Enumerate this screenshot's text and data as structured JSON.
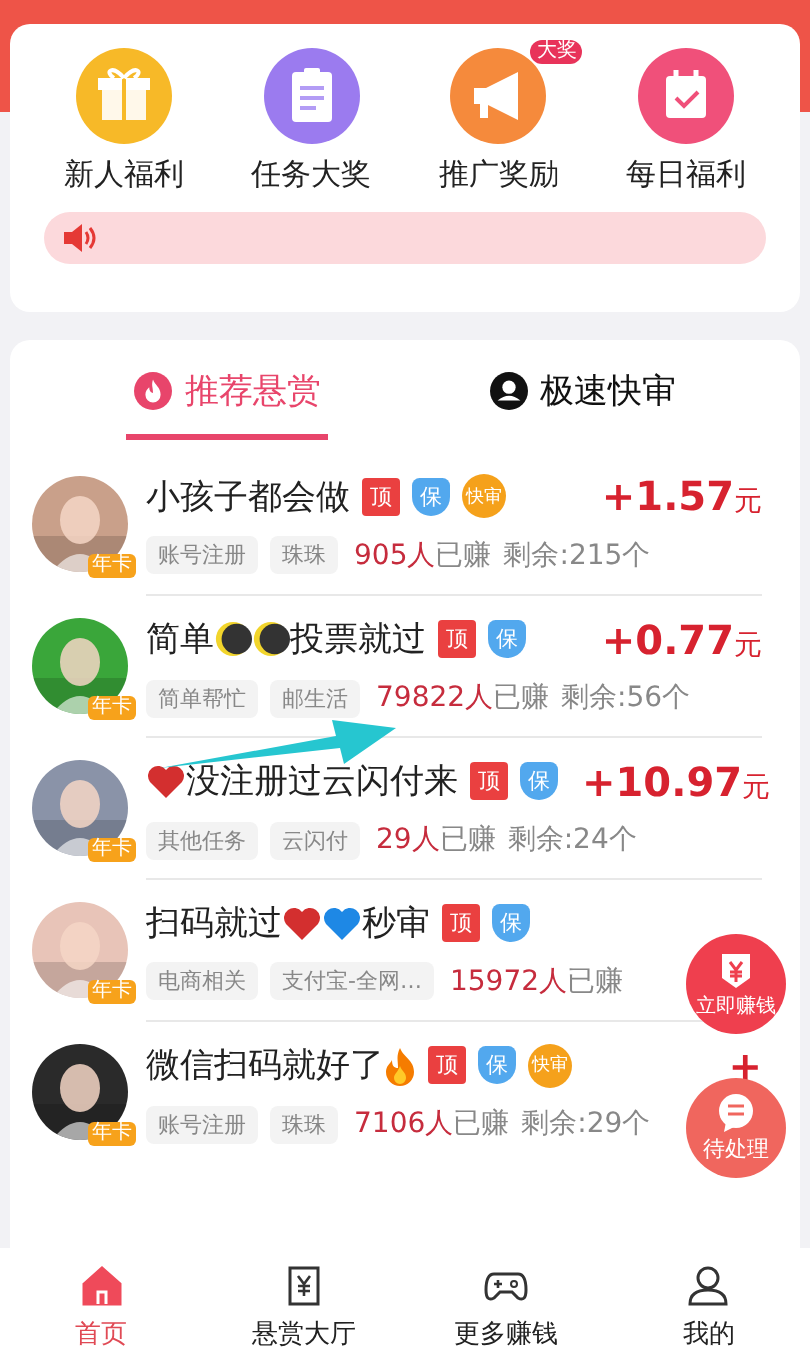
{
  "shortcuts": [
    {
      "kind": "gift",
      "label": "新人福利"
    },
    {
      "kind": "clipboard",
      "label": "任务大奖"
    },
    {
      "kind": "megaphone",
      "label": "推广奖励",
      "badge": "大奖"
    },
    {
      "kind": "calendar",
      "label": "每日福利"
    }
  ],
  "tabs": [
    {
      "label": "推荐悬赏",
      "kind": "fire",
      "selected": true
    },
    {
      "label": "极速快审",
      "kind": "person",
      "selected": false
    }
  ],
  "tasks": [
    {
      "avatar_badge": "年卡",
      "title": [
        {
          "kind": "text",
          "text": "小孩子都会做"
        }
      ],
      "badges": [
        {
          "kind": "top",
          "text": "顶"
        },
        {
          "kind": "guarantee",
          "text": "保"
        },
        {
          "kind": "fast",
          "text": "快审"
        }
      ],
      "price": "+1.57",
      "unit": "元",
      "tags": [
        "账号注册",
        "珠珠"
      ],
      "earned": "905人",
      "earned_suffix": "已赚",
      "remaining": "剩余:215个"
    },
    {
      "avatar_badge": "年卡",
      "title": [
        {
          "kind": "text",
          "text": "简单"
        },
        {
          "kind": "moon"
        },
        {
          "kind": "moon"
        },
        {
          "kind": "text",
          "text": "投票就过"
        }
      ],
      "badges": [
        {
          "kind": "top",
          "text": "顶"
        },
        {
          "kind": "guarantee",
          "text": "保"
        }
      ],
      "price": "+0.77",
      "unit": "元",
      "tags": [
        "简单帮忙",
        "邮生活"
      ],
      "earned": "79822人",
      "earned_suffix": "已赚",
      "remaining": "剩余:56个"
    },
    {
      "avatar_badge": "年卡",
      "title": [
        {
          "kind": "heart",
          "color": "#d32f2f"
        },
        {
          "kind": "text",
          "text": "没注册过云闪付来"
        }
      ],
      "badges": [
        {
          "kind": "top",
          "text": "顶"
        },
        {
          "kind": "guarantee",
          "text": "保"
        }
      ],
      "price": "+10.97",
      "unit": "元",
      "tags": [
        "其他任务",
        "云闪付"
      ],
      "earned": "29人",
      "earned_suffix": "已赚",
      "remaining": "剩余:24个"
    },
    {
      "avatar_badge": "年卡",
      "title": [
        {
          "kind": "text",
          "text": "扫码就过"
        },
        {
          "kind": "heart",
          "color": "#d32f2f"
        },
        {
          "kind": "heart",
          "color": "#1e88e5"
        },
        {
          "kind": "text",
          "text": "秒审"
        }
      ],
      "badges": [
        {
          "kind": "top",
          "text": "顶"
        },
        {
          "kind": "guarantee",
          "text": "保"
        }
      ],
      "tags": [
        "电商相关",
        "支付宝-全网…"
      ],
      "earned": "15972人",
      "earned_suffix": "已赚"
    },
    {
      "avatar_badge": "年卡",
      "title": [
        {
          "kind": "text",
          "text": "微信扫码就好了"
        },
        {
          "kind": "fire"
        }
      ],
      "badges": [
        {
          "kind": "top",
          "text": "顶"
        },
        {
          "kind": "guarantee",
          "text": "保"
        },
        {
          "kind": "fast",
          "text": "快审"
        }
      ],
      "price": "+",
      "tags": [
        "账号注册",
        "珠珠"
      ],
      "earned": "7106人",
      "earned_suffix": "已赚",
      "remaining": "剩余:29个"
    }
  ],
  "floating": [
    {
      "kind": "money",
      "label": "立即赚钱"
    },
    {
      "kind": "chat",
      "label": "待处理"
    }
  ],
  "nav": [
    {
      "kind": "home",
      "label": "首页",
      "selected": true
    },
    {
      "kind": "yen",
      "label": "悬赏大厅",
      "selected": false
    },
    {
      "kind": "gamepad",
      "label": "更多赚钱",
      "selected": false
    },
    {
      "kind": "user",
      "label": "我的",
      "selected": false
    }
  ]
}
